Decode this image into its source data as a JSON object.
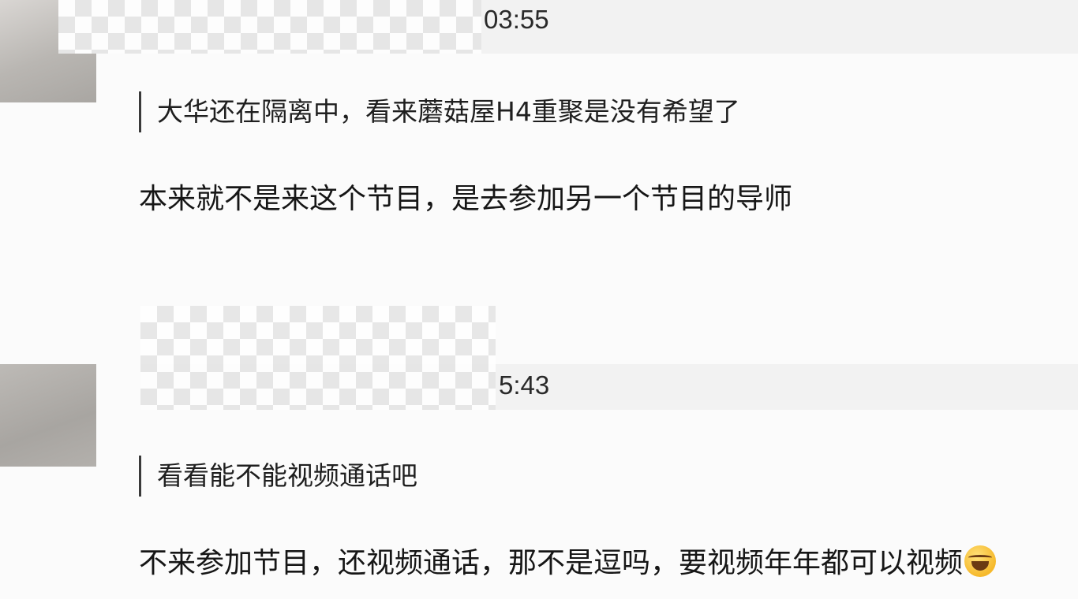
{
  "comments": [
    {
      "timestamp": "03:55",
      "quote": "大华还在隔离中，看来蘑菇屋H4重聚是没有希望了",
      "reply": "本来就不是来这个节目，是去参加另一个节目的导师"
    },
    {
      "timestamp": "5:43",
      "quote": "看看能不能视频通话吧",
      "reply": "不来参加节目，还视频通话，那不是逗吗，要视频年年都可以视频",
      "reply_emoji": "laughing-with-tears-emoji"
    }
  ]
}
